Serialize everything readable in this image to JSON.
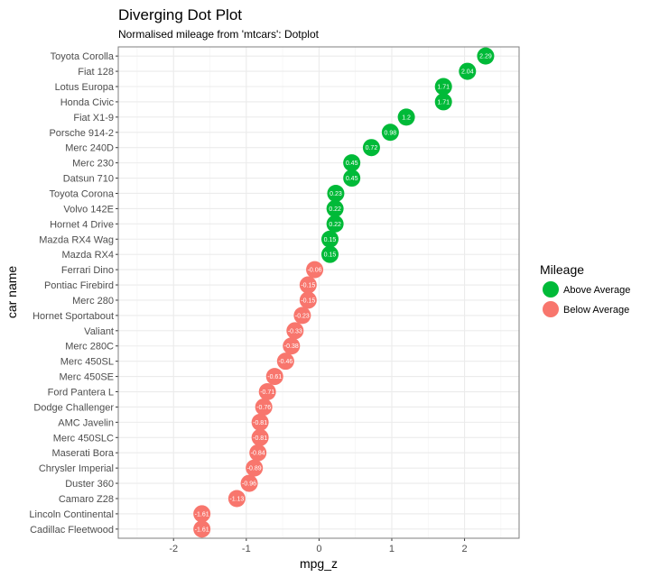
{
  "chart_data": {
    "type": "scatter",
    "title": "Diverging Dot Plot",
    "subtitle": "Normalised mileage from 'mtcars': Dotplot",
    "xlabel": "mpg_z",
    "ylabel": "car name",
    "xlim": [
      -2.76,
      2.75
    ],
    "xticks": [
      -2,
      -1,
      0,
      1,
      2
    ],
    "xtick_labels": [
      "-2",
      "-1",
      "0",
      "1",
      "2"
    ],
    "grid": true,
    "legend": {
      "title": "Mileage",
      "position": "right",
      "entries": [
        {
          "label": "Above Average",
          "color": "#00ba38"
        },
        {
          "label": "Below Average",
          "color": "#f8766d"
        }
      ]
    },
    "points": [
      {
        "car": "Toyota Corolla",
        "value": 2.29,
        "label": "2.29",
        "group": "Above Average"
      },
      {
        "car": "Fiat 128",
        "value": 2.04,
        "label": "2.04",
        "group": "Above Average"
      },
      {
        "car": "Lotus Europa",
        "value": 1.71,
        "label": "1.71",
        "group": "Above Average"
      },
      {
        "car": "Honda Civic",
        "value": 1.71,
        "label": "1.71",
        "group": "Above Average"
      },
      {
        "car": "Fiat X1-9",
        "value": 1.2,
        "label": "1.2",
        "group": "Above Average"
      },
      {
        "car": "Porsche 914-2",
        "value": 0.98,
        "label": "0.98",
        "group": "Above Average"
      },
      {
        "car": "Merc 240D",
        "value": 0.72,
        "label": "0.72",
        "group": "Above Average"
      },
      {
        "car": "Merc 230",
        "value": 0.45,
        "label": "0.45",
        "group": "Above Average"
      },
      {
        "car": "Datsun 710",
        "value": 0.45,
        "label": "0.45",
        "group": "Above Average"
      },
      {
        "car": "Toyota Corona",
        "value": 0.23,
        "label": "0.23",
        "group": "Above Average"
      },
      {
        "car": "Volvo 142E",
        "value": 0.22,
        "label": "0.22",
        "group": "Above Average"
      },
      {
        "car": "Hornet 4 Drive",
        "value": 0.22,
        "label": "0.22",
        "group": "Above Average"
      },
      {
        "car": "Mazda RX4 Wag",
        "value": 0.15,
        "label": "0.15",
        "group": "Above Average"
      },
      {
        "car": "Mazda RX4",
        "value": 0.15,
        "label": "0.15",
        "group": "Above Average"
      },
      {
        "car": "Ferrari Dino",
        "value": -0.06,
        "label": "-0.06",
        "group": "Below Average"
      },
      {
        "car": "Pontiac Firebird",
        "value": -0.15,
        "label": "-0.15",
        "group": "Below Average"
      },
      {
        "car": "Merc 280",
        "value": -0.15,
        "label": "-0.15",
        "group": "Below Average"
      },
      {
        "car": "Hornet Sportabout",
        "value": -0.23,
        "label": "-0.23",
        "group": "Below Average"
      },
      {
        "car": "Valiant",
        "value": -0.33,
        "label": "-0.33",
        "group": "Below Average"
      },
      {
        "car": "Merc 280C",
        "value": -0.38,
        "label": "-0.38",
        "group": "Below Average"
      },
      {
        "car": "Merc 450SL",
        "value": -0.46,
        "label": "-0.46",
        "group": "Below Average"
      },
      {
        "car": "Merc 450SE",
        "value": -0.61,
        "label": "-0.61",
        "group": "Below Average"
      },
      {
        "car": "Ford Pantera L",
        "value": -0.71,
        "label": "-0.71",
        "group": "Below Average"
      },
      {
        "car": "Dodge Challenger",
        "value": -0.76,
        "label": "-0.76",
        "group": "Below Average"
      },
      {
        "car": "AMC Javelin",
        "value": -0.81,
        "label": "-0.81",
        "group": "Below Average"
      },
      {
        "car": "Merc 450SLC",
        "value": -0.81,
        "label": "-0.81",
        "group": "Below Average"
      },
      {
        "car": "Maserati Bora",
        "value": -0.84,
        "label": "-0.84",
        "group": "Below Average"
      },
      {
        "car": "Chrysler Imperial",
        "value": -0.89,
        "label": "-0.89",
        "group": "Below Average"
      },
      {
        "car": "Duster 360",
        "value": -0.96,
        "label": "-0.96",
        "group": "Below Average"
      },
      {
        "car": "Camaro Z28",
        "value": -1.13,
        "label": "-1.13",
        "group": "Below Average"
      },
      {
        "car": "Lincoln Continental",
        "value": -1.61,
        "label": "-1.61",
        "group": "Below Average"
      },
      {
        "car": "Cadillac Fleetwood",
        "value": -1.61,
        "label": "-1.61",
        "group": "Below Average"
      }
    ]
  }
}
